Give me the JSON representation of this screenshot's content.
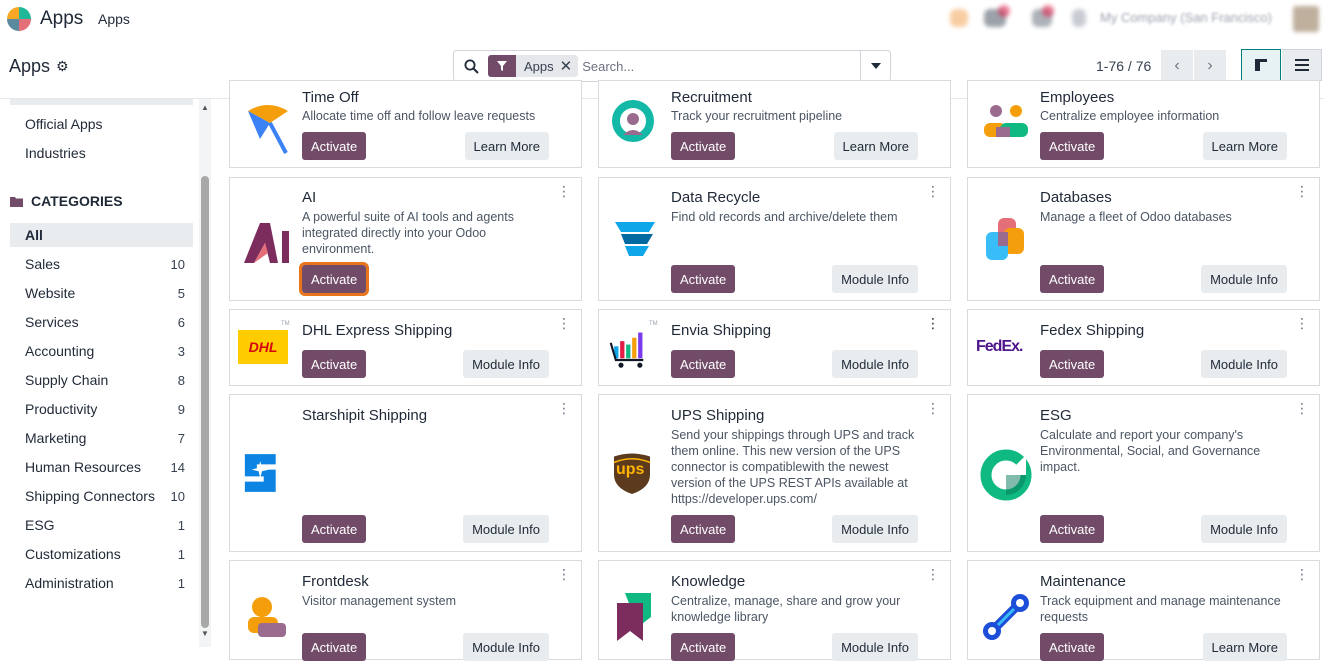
{
  "topbar": {
    "app_name": "Apps",
    "menu": "Apps",
    "company": "My Company (San Francisco)"
  },
  "control_panel": {
    "title": "Apps",
    "facet": "Apps",
    "search_placeholder": "Search...",
    "pager": "1-76 / 76"
  },
  "sidebar": {
    "top_items": [
      "Official Apps",
      "Industries"
    ],
    "categories_title": "CATEGORIES",
    "categories": [
      {
        "label": "All",
        "count": ""
      },
      {
        "label": "Sales",
        "count": "10"
      },
      {
        "label": "Website",
        "count": "5"
      },
      {
        "label": "Services",
        "count": "6"
      },
      {
        "label": "Accounting",
        "count": "3"
      },
      {
        "label": "Supply Chain",
        "count": "8"
      },
      {
        "label": "Productivity",
        "count": "9"
      },
      {
        "label": "Marketing",
        "count": "7"
      },
      {
        "label": "Human Resources",
        "count": "14"
      },
      {
        "label": "Shipping Connectors",
        "count": "10"
      },
      {
        "label": "ESG",
        "count": "1"
      },
      {
        "label": "Customizations",
        "count": "1"
      },
      {
        "label": "Administration",
        "count": "1"
      }
    ]
  },
  "apps": [
    {
      "title": "Time Off",
      "desc": "Allocate time off and follow leave requests",
      "primary": "Activate",
      "secondary": "Learn More",
      "icon": "time-off-icon"
    },
    {
      "title": "Recruitment",
      "desc": "Track your recruitment pipeline",
      "primary": "Activate",
      "secondary": "Learn More",
      "icon": "recruitment-icon"
    },
    {
      "title": "Employees",
      "desc": "Centralize employee information",
      "primary": "Activate",
      "secondary": "Learn More",
      "icon": "employees-icon"
    },
    {
      "title": "AI",
      "desc": "A powerful suite of AI tools and agents integrated directly into your Odoo environment.",
      "primary": "Activate",
      "secondary": "",
      "icon": "ai-icon"
    },
    {
      "title": "Data Recycle",
      "desc": "Find old records and archive/delete them",
      "primary": "Activate",
      "secondary": "Module Info",
      "icon": "data-recycle-icon"
    },
    {
      "title": "Databases",
      "desc": "Manage a fleet of Odoo databases",
      "primary": "Activate",
      "secondary": "Module Info",
      "icon": "databases-icon"
    },
    {
      "title": "DHL Express Shipping",
      "desc": "",
      "primary": "Activate",
      "secondary": "Module Info",
      "icon": "dhl-logo",
      "logo_text": "DHL"
    },
    {
      "title": "Envia Shipping",
      "desc": "",
      "primary": "Activate",
      "secondary": "Module Info",
      "icon": "envia-logo"
    },
    {
      "title": "Fedex Shipping",
      "desc": "",
      "primary": "Activate",
      "secondary": "Module Info",
      "icon": "fedex-logo",
      "logo_text": "FedEx."
    },
    {
      "title": "Starshipit Shipping",
      "desc": "",
      "primary": "Activate",
      "secondary": "Module Info",
      "icon": "starshipit-logo"
    },
    {
      "title": "UPS Shipping",
      "desc": "Send your shippings through UPS and track them online. This new version of the UPS connector is compatiblewith the newest version of the UPS REST APIs available at https://developer.ups.com/",
      "primary": "Activate",
      "secondary": "Module Info",
      "icon": "ups-logo",
      "logo_text": "ups"
    },
    {
      "title": "ESG",
      "desc": "Calculate and report your company's Environmental, Social, and Governance impact.",
      "primary": "Activate",
      "secondary": "Module Info",
      "icon": "esg-icon"
    },
    {
      "title": "Frontdesk",
      "desc": "Visitor management system",
      "primary": "Activate",
      "secondary": "Module Info",
      "icon": "frontdesk-icon"
    },
    {
      "title": "Knowledge",
      "desc": "Centralize, manage, share and grow your knowledge library",
      "primary": "Activate",
      "secondary": "Module Info",
      "icon": "knowledge-icon"
    },
    {
      "title": "Maintenance",
      "desc": "Track equipment and manage maintenance requests",
      "primary": "Activate",
      "secondary": "Learn More",
      "icon": "maintenance-icon"
    }
  ],
  "colors": {
    "brand": "#714b67",
    "focus": "#e8741c",
    "active_view": "#017e84"
  }
}
